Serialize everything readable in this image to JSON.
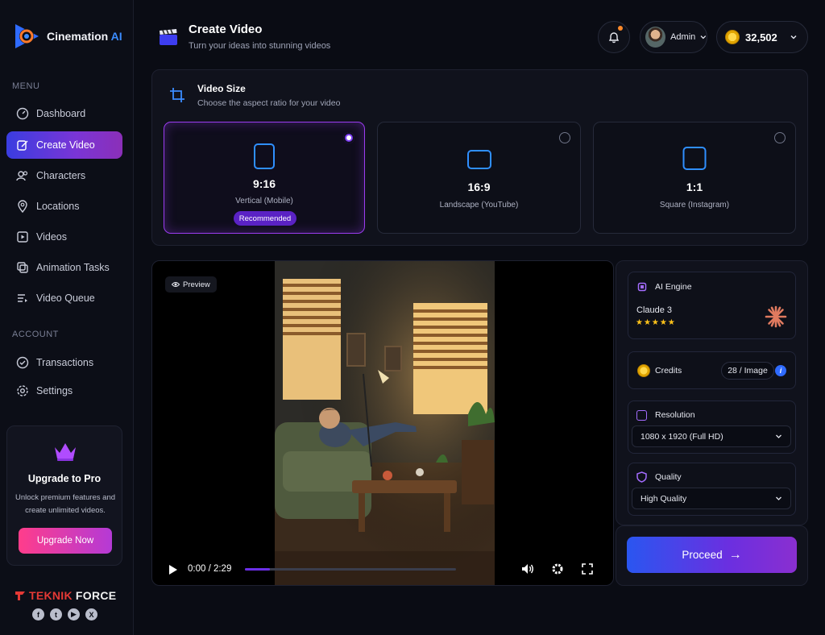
{
  "brand": {
    "name": "Cinemation",
    "suffix": " AI"
  },
  "sidebar": {
    "menu_label": "MENU",
    "menu": [
      {
        "label": "Dashboard",
        "icon": "gauge-icon"
      },
      {
        "label": "Create Video",
        "icon": "edit-icon",
        "active": true
      },
      {
        "label": "Characters",
        "icon": "users-icon"
      },
      {
        "label": "Locations",
        "icon": "map-pin-icon"
      },
      {
        "label": "Videos",
        "icon": "video-icon"
      },
      {
        "label": "Animation Tasks",
        "icon": "layers-icon"
      },
      {
        "label": "Video Queue",
        "icon": "queue-icon"
      }
    ],
    "account_label": "ACCOUNT",
    "account": [
      {
        "label": "Transactions",
        "icon": "check-circle-icon"
      },
      {
        "label": "Settings",
        "icon": "gear-icon"
      }
    ],
    "upgrade": {
      "title": "Upgrade to Pro",
      "desc": "Unlock premium features and create unlimited videos.",
      "button": "Upgrade Now"
    },
    "footer": {
      "brand_a": "TEKNIK",
      "brand_b": "FORCE",
      "socials": [
        "facebook-icon",
        "twitter-icon",
        "youtube-icon",
        "x-icon"
      ]
    }
  },
  "header": {
    "title": "Create Video",
    "subtitle": "Turn your ideas into stunning videos",
    "user": "Admin",
    "credits": "32,502"
  },
  "video_size": {
    "title": "Video Size",
    "subtitle": "Choose the aspect ratio for your video",
    "options": [
      {
        "ratio": "9:16",
        "desc": "Vertical (Mobile)",
        "badge": "Recommended",
        "selected": true
      },
      {
        "ratio": "16:9",
        "desc": "Landscape (YouTube)",
        "selected": false
      },
      {
        "ratio": "1:1",
        "desc": "Square (Instagram)",
        "selected": false
      }
    ]
  },
  "player": {
    "preview_label": "Preview",
    "time": "0:00 / 2:29",
    "progress": 0.12
  },
  "settings": {
    "ai_engine": {
      "label": "AI Engine",
      "model": "Claude 3",
      "rating": "★★★★★"
    },
    "credits": {
      "label": "Credits",
      "value": "28 / Image"
    },
    "resolution": {
      "label": "Resolution",
      "value": "1080 x 1920 (Full HD)"
    },
    "quality": {
      "label": "Quality",
      "value": "High Quality"
    }
  },
  "proceed": {
    "label": "Proceed",
    "arrow": "→"
  },
  "colors": {
    "accent": "#7b3cf0",
    "blue": "#2f8fff",
    "bg": "#0a0c14"
  }
}
